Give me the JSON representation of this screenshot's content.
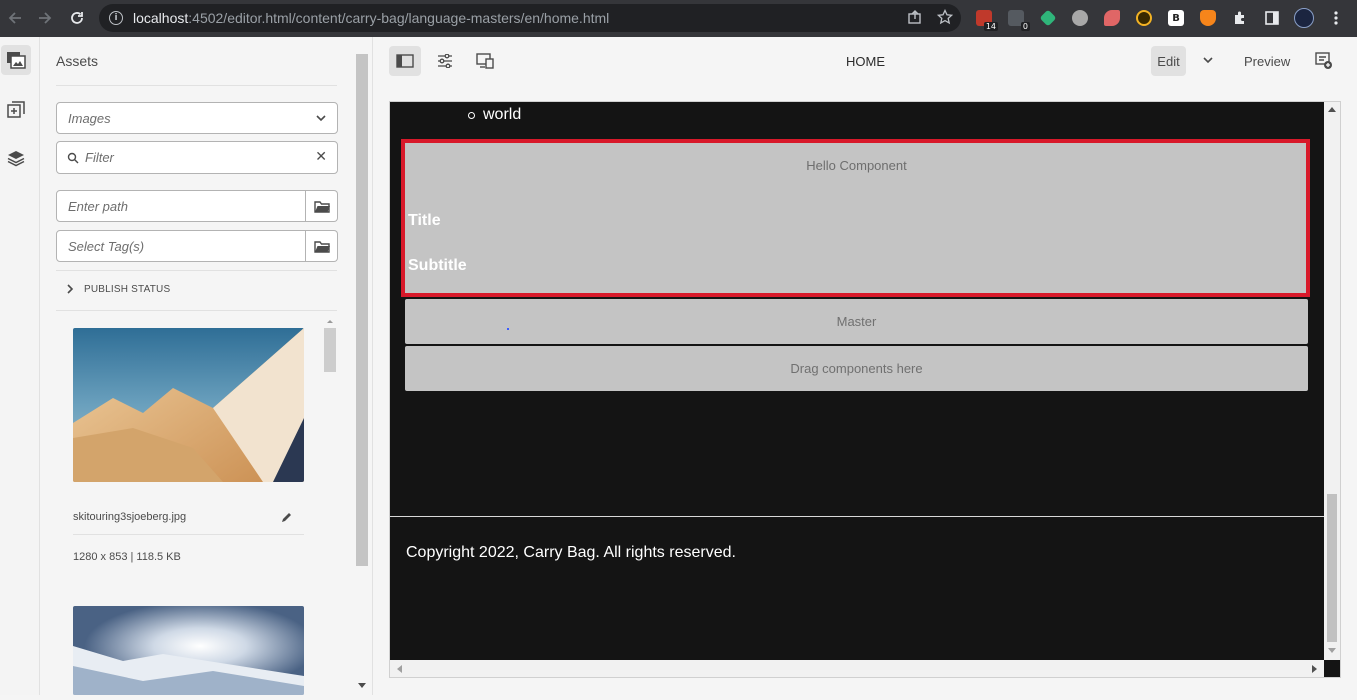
{
  "browser": {
    "url_host": "localhost",
    "url_rest": ":4502/editor.html/content/carry-bag/language-masters/en/home.html",
    "extensions": [
      {
        "name": "ublock-icon",
        "color": "#c0392b",
        "badge": "14"
      },
      {
        "name": "ghostery-icon",
        "color": "#555a60",
        "badge": "0"
      },
      {
        "name": "gem-extension-icon",
        "color": "#2fb57a",
        "badge": ""
      },
      {
        "name": "owl-extension-icon",
        "color": "#a8a8a8",
        "badge": ""
      },
      {
        "name": "eraser-extension-icon",
        "color": "#e06666",
        "badge": ""
      },
      {
        "name": "record-extension-icon",
        "color": "#f3b324",
        "badge": ""
      },
      {
        "name": "b-extension-icon",
        "color": "#ffffff",
        "badge": ""
      },
      {
        "name": "metamask-icon",
        "color": "#f6851b",
        "badge": ""
      }
    ]
  },
  "sidepanel": {
    "title": "Assets",
    "type_select": "Images",
    "filter_placeholder": "Filter",
    "path_placeholder": "Enter path",
    "tag_placeholder": "Select Tag(s)",
    "publish_status": "PUBLISH STATUS",
    "asset": {
      "name": "skitouring3sjoeberg.jpg",
      "meta": "1280 x 853 | 118.5 KB"
    }
  },
  "toolbar": {
    "page_name": "HOME",
    "edit_label": "Edit",
    "preview_label": "Preview"
  },
  "canvas": {
    "list_item": "world",
    "hello_component_label": "Hello Component",
    "hello_title": "Title",
    "hello_subtitle": "Subtitle",
    "master_label": "Master",
    "drag_label": "Drag components here",
    "copyright": "Copyright 2022, Carry Bag. All rights reserved."
  },
  "colors": {
    "selection_outline": "#d8192a",
    "page_background": "#141414",
    "placeholder_bg": "#c4c4c4"
  }
}
